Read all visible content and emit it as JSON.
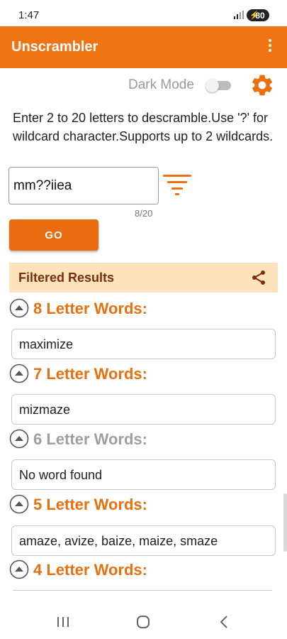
{
  "status": {
    "time": "1:47",
    "battery": "80"
  },
  "app": {
    "title": "Unscrambler",
    "accent_color": "#f07314"
  },
  "dark_mode": {
    "label": "Dark Mode",
    "enabled": false
  },
  "instructions": "Enter 2 to 20 letters to descramble.Use '?' for wildcard character.Supports up to 2 wildcards.",
  "input": {
    "value": "mm??iiea",
    "counter": "8/20"
  },
  "go_label": "GO",
  "filtered": {
    "label": "Filtered Results"
  },
  "sections": [
    {
      "title": "8 Letter Words:",
      "result": "maximize",
      "has_results": true
    },
    {
      "title": "7 Letter Words:",
      "result": "mizmaze",
      "has_results": true
    },
    {
      "title": "6 Letter Words:",
      "result": "No word found",
      "has_results": false
    },
    {
      "title": "5 Letter Words:",
      "result": "amaze, avize, baize, maize, smaze",
      "has_results": true
    },
    {
      "title": "4 Letter Words:",
      "result": "",
      "has_results": true
    }
  ],
  "icons": {
    "overflow": "more-vert-icon",
    "settings": "gear-icon",
    "filter": "filter-icon",
    "share": "share-icon",
    "collapse": "chevron-up-circle-icon"
  }
}
